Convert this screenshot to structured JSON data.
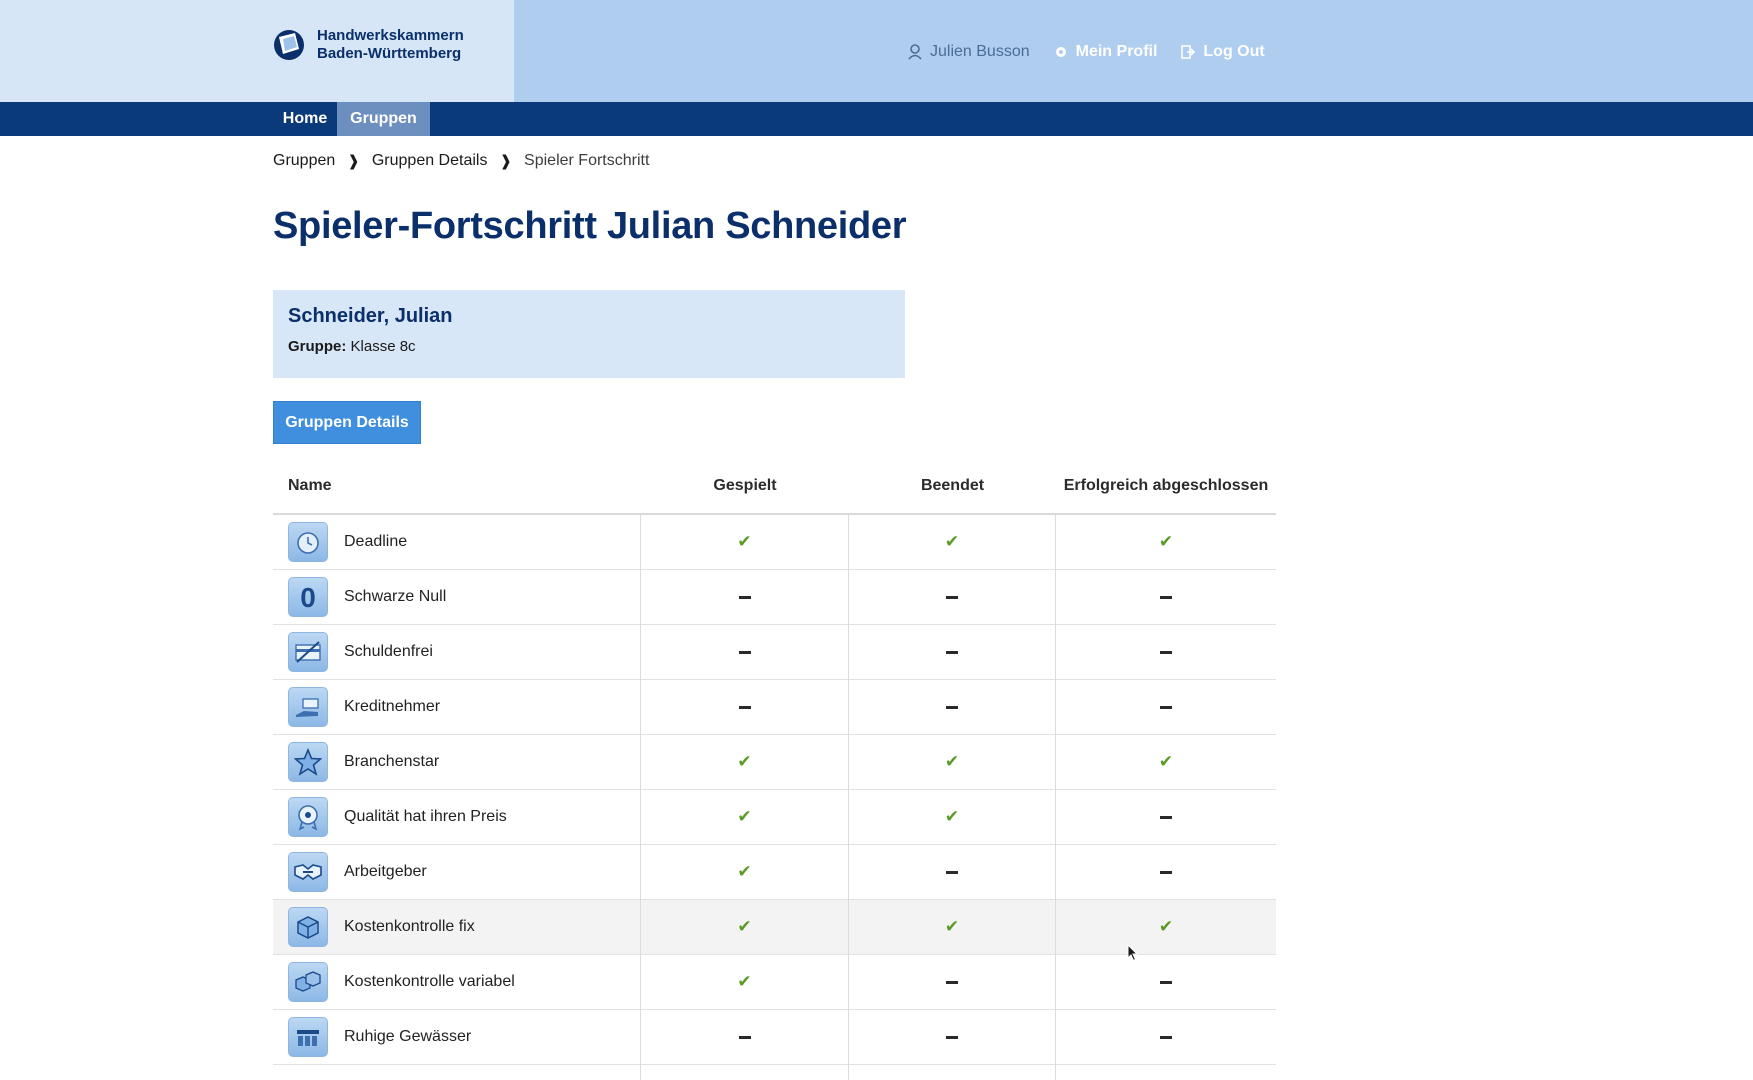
{
  "header": {
    "org_line1": "Handwerkskammern",
    "org_line2": "Baden-Württemberg",
    "user_name": "Julien Busson",
    "profile_label": "Mein Profil",
    "logout_label": "Log Out"
  },
  "nav": {
    "home": "Home",
    "gruppen": "Gruppen"
  },
  "breadcrumb": [
    "Gruppen",
    "Gruppen Details",
    "Spieler Fortschritt"
  ],
  "breadcrumb_sep": "❱",
  "page_title": "Spieler-Fortschritt Julian Schneider",
  "player": {
    "name": "Schneider, Julian",
    "group_label": "Gruppe:",
    "group_value": "Klasse 8c"
  },
  "button_label": "Gruppen Details",
  "table": {
    "headers": [
      "Name",
      "Gespielt",
      "Beendet",
      "Erfolgreich abgeschlossen"
    ],
    "rows": [
      {
        "name": "Deadline",
        "icon": "stopwatch-icon",
        "gespielt": true,
        "beendet": true,
        "erfolgreich": true
      },
      {
        "name": "Schwarze Null",
        "icon": "zero-icon",
        "gespielt": false,
        "beendet": false,
        "erfolgreich": false
      },
      {
        "name": "Schuldenfrei",
        "icon": "card-crossed-icon",
        "gespielt": false,
        "beendet": false,
        "erfolgreich": false
      },
      {
        "name": "Kreditnehmer",
        "icon": "hand-money-icon",
        "gespielt": false,
        "beendet": false,
        "erfolgreich": false
      },
      {
        "name": "Branchenstar",
        "icon": "star-icon",
        "gespielt": true,
        "beendet": true,
        "erfolgreich": true
      },
      {
        "name": "Qualität hat ihren Preis",
        "icon": "medal-icon",
        "gespielt": true,
        "beendet": true,
        "erfolgreich": false
      },
      {
        "name": "Arbeitgeber",
        "icon": "handshake-icon",
        "gespielt": true,
        "beendet": false,
        "erfolgreich": false
      },
      {
        "name": "Kostenkontrolle fix",
        "icon": "box-icon",
        "gespielt": true,
        "beendet": true,
        "erfolgreich": true
      },
      {
        "name": "Kostenkontrolle variabel",
        "icon": "boxes-icon",
        "gespielt": true,
        "beendet": false,
        "erfolgreich": false
      },
      {
        "name": "Ruhige Gewässer",
        "icon": "bars-icon",
        "gespielt": false,
        "beendet": false,
        "erfolgreich": false
      }
    ]
  },
  "colors": {
    "brand_dark": "#0b3a7a",
    "header_light": "#aecdef",
    "button": "#3f8fde",
    "check": "#5b9a25"
  }
}
